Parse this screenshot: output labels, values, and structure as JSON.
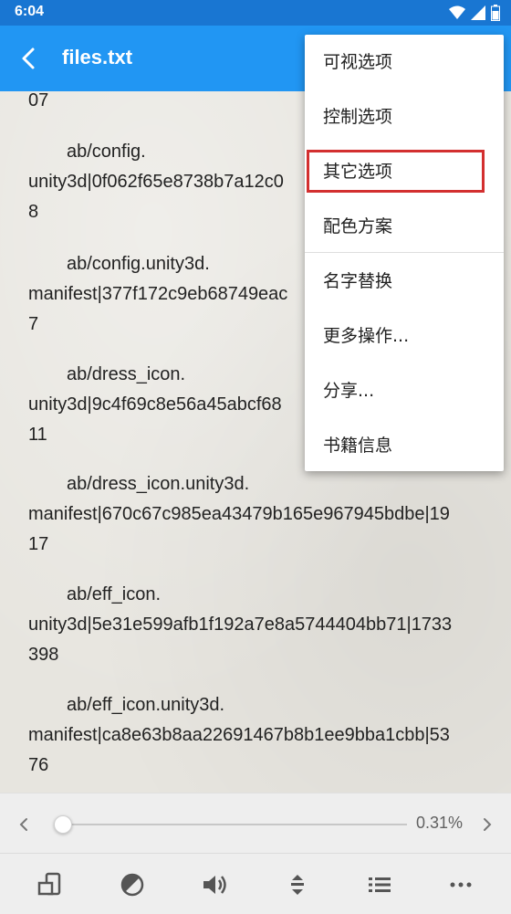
{
  "status_bar": {
    "time": "6:04"
  },
  "app_bar": {
    "title": "files.txt"
  },
  "reader": {
    "top_fragment": "07",
    "paragraphs": [
      {
        "lines": [
          "ab/config.",
          "unity3d|0f062f65e8738b7a12c0",
          "8"
        ]
      },
      {
        "lines": [
          "ab/config.unity3d.",
          "manifest|377f172c9eb68749eac",
          "7"
        ]
      },
      {
        "lines": [
          "ab/dress_icon.",
          "unity3d|9c4f69c8e56a45abcf68",
          "11"
        ]
      },
      {
        "lines": [
          "ab/dress_icon.unity3d.",
          "manifest|670c67c985ea43479b165e967945bdbe|19",
          "17"
        ]
      },
      {
        "lines": [
          "ab/eff_icon.",
          "unity3d|5e31e599afb1f192a7e8a5744404bb71|1733",
          "398"
        ]
      },
      {
        "lines": [
          "ab/eff_icon.unity3d.",
          "manifest|ca8e63b8aa22691467b8b1ee9bba1cbb|53",
          "76"
        ]
      }
    ]
  },
  "progress": {
    "percent_label": "0.31%",
    "value": 0.0031
  },
  "menu": {
    "items": [
      {
        "label": "可视选项"
      },
      {
        "label": "控制选项"
      },
      {
        "label": "其它选项"
      },
      {
        "label": "配色方案"
      },
      {
        "label": "名字替换"
      },
      {
        "label": "更多操作..."
      },
      {
        "label": "分享..."
      },
      {
        "label": "书籍信息"
      }
    ],
    "highlighted_index": 2
  },
  "toolbar": {
    "icons": [
      "screen-rotation-icon",
      "contrast-icon",
      "volume-icon",
      "scroll-icon",
      "list-icon",
      "more-icon"
    ]
  },
  "colors": {
    "app_bar": "#2196f3",
    "status_bar": "#1976d2",
    "highlight": "#d32f2f"
  }
}
